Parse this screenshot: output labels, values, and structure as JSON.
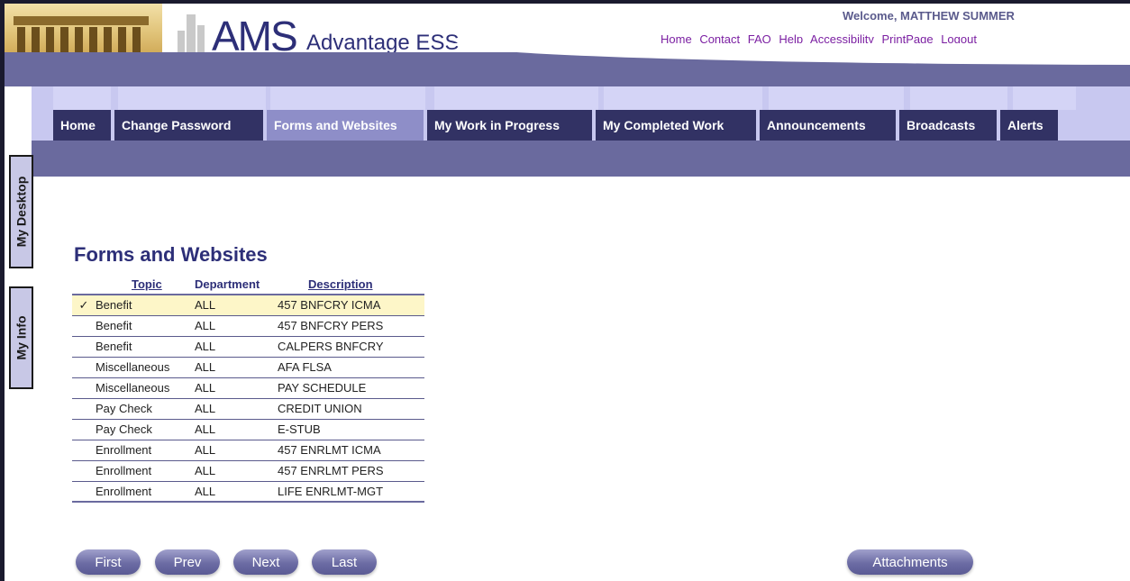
{
  "header": {
    "logo_main": "AMS",
    "logo_sub": "Advantage ESS",
    "welcome": "Welcome, MATTHEW SUMMER",
    "links": [
      "Home",
      "Contact",
      "FAQ",
      "Help",
      "Accessibility",
      "PrintPage",
      "Logout"
    ]
  },
  "tabs": [
    "Home",
    "Change Password",
    "Forms and Websites",
    "My Work in Progress",
    "My Completed Work",
    "Announcements",
    "Broadcasts",
    "Alerts"
  ],
  "active_tab": "Forms and Websites",
  "side_tabs": [
    "My Desktop",
    "My Info"
  ],
  "page": {
    "title": "Forms and Websites",
    "columns": [
      "Topic",
      "Department",
      "Description"
    ],
    "rows": [
      {
        "topic": "Benefit",
        "department": "ALL",
        "description": "457 BNFCRY ICMA",
        "selected": true
      },
      {
        "topic": "Benefit",
        "department": "ALL",
        "description": "457 BNFCRY PERS"
      },
      {
        "topic": "Benefit",
        "department": "ALL",
        "description": "CALPERS BNFCRY"
      },
      {
        "topic": "Miscellaneous",
        "department": "ALL",
        "description": "AFA FLSA"
      },
      {
        "topic": "Miscellaneous",
        "department": "ALL",
        "description": "PAY SCHEDULE"
      },
      {
        "topic": "Pay Check",
        "department": "ALL",
        "description": "CREDIT UNION"
      },
      {
        "topic": "Pay Check",
        "department": "ALL",
        "description": "E-STUB"
      },
      {
        "topic": "Enrollment",
        "department": "ALL",
        "description": "457 ENRLMT ICMA"
      },
      {
        "topic": "Enrollment",
        "department": "ALL",
        "description": "457 ENRLMT PERS"
      },
      {
        "topic": "Enrollment",
        "department": "ALL",
        "description": "LIFE ENRLMT-MGT"
      }
    ],
    "check_glyph": "✓"
  },
  "buttons": {
    "first": "First",
    "prev": "Prev",
    "next": "Next",
    "last": "Last",
    "attachments": "Attachments"
  },
  "colors": {
    "brand": "#2d2f78",
    "tab_bg": "#323264",
    "tab_active": "#8e8ec8",
    "band": "#6a6a9e",
    "selected_row": "#fdf6c8",
    "link": "#7b1fa2"
  }
}
